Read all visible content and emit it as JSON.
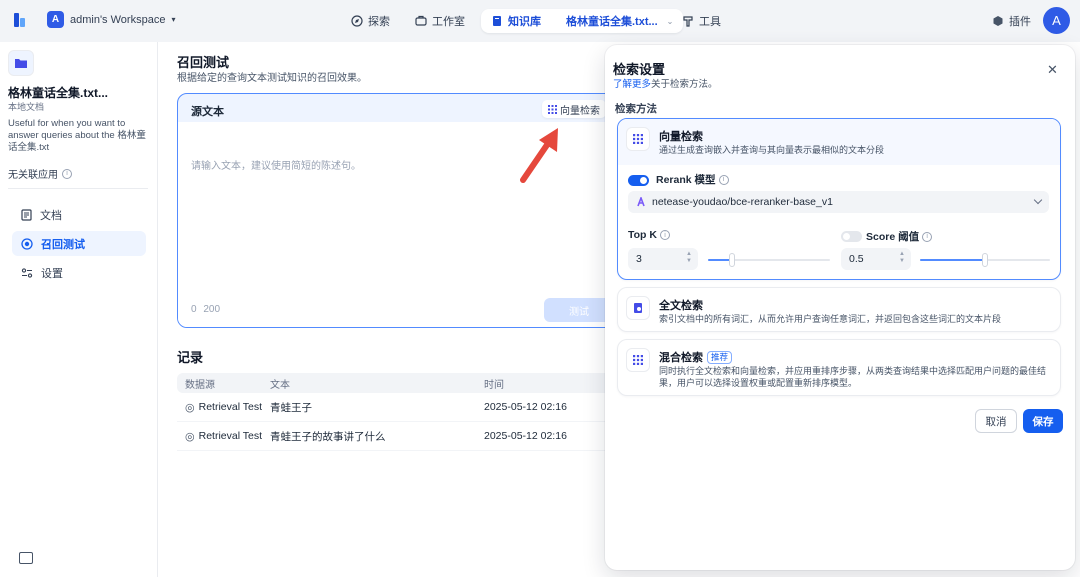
{
  "topbar": {
    "workspace_initial": "A",
    "workspace_name": "admin's Workspace",
    "nav": {
      "explore": "探索",
      "studio": "工作室",
      "knowledge": "知识库",
      "dataset_name": "格林童话全集.txt...",
      "tools": "工具"
    },
    "plugins": "插件",
    "user_initial": "A"
  },
  "sidebar": {
    "doc_title": "格林童话全集.txt...",
    "doc_subtitle": "本地文档",
    "doc_description": "Useful for when you want to answer queries about the 格林童话全集.txt",
    "no_linked_apps": "无关联应用",
    "items": [
      {
        "label": "文档",
        "icon": "document-icon"
      },
      {
        "label": "召回测试",
        "icon": "target-icon"
      },
      {
        "label": "设置",
        "icon": "settings-icon"
      }
    ]
  },
  "main": {
    "title": "召回测试",
    "subtitle": "根据给定的查询文本测试知识的召回效果。",
    "source": {
      "label": "源文本",
      "method_badge": "向量检索",
      "placeholder": "请输入文本，建议使用简短的陈述句。",
      "char_count": "0",
      "char_limit": "200",
      "test_button": "测试"
    },
    "records": {
      "title": "记录",
      "headers": [
        "数据源",
        "文本",
        "时间"
      ],
      "rows": [
        {
          "source": "Retrieval Test",
          "text": "青蛙王子",
          "time": "2025-05-12 02:16"
        },
        {
          "source": "Retrieval Test",
          "text": "青蛙王子的故事讲了什么",
          "time": "2025-05-12 02:16"
        }
      ]
    }
  },
  "panel": {
    "title": "检索设置",
    "learn_more_link": "了解更多",
    "learn_more_suffix": "关于检索方法。",
    "method_label": "检索方法",
    "vector": {
      "name": "向量检索",
      "desc": "通过生成查询嵌入并查询与其向量表示最相似的文本分段",
      "rerank_label": "Rerank 模型",
      "rerank_enabled": true,
      "rerank_model": "netease-youdao/bce-reranker-base_v1",
      "topk_label": "Top K",
      "topk_value": "3",
      "topk_fraction": 0.2,
      "score_label": "Score 阈值",
      "score_enabled": false,
      "score_value": "0.5",
      "score_fraction": 0.5
    },
    "fulltext": {
      "name": "全文检索",
      "desc": "索引文档中的所有词汇，从而允许用户查询任意词汇，并返回包含这些词汇的文本片段"
    },
    "hybrid": {
      "name": "混合检索",
      "tag": "推荐",
      "desc": "同时执行全文检索和向量检索，并应用重排序步骤，从两类查询结果中选择匹配用户问题的最佳结果，用户可以选择设置权重或配置重新排序模型。"
    },
    "cancel": "取消",
    "save": "保存"
  },
  "colors": {
    "accent": "#155eef",
    "selected_border": "#528bff",
    "annotation_arrow": "#e5483c"
  }
}
